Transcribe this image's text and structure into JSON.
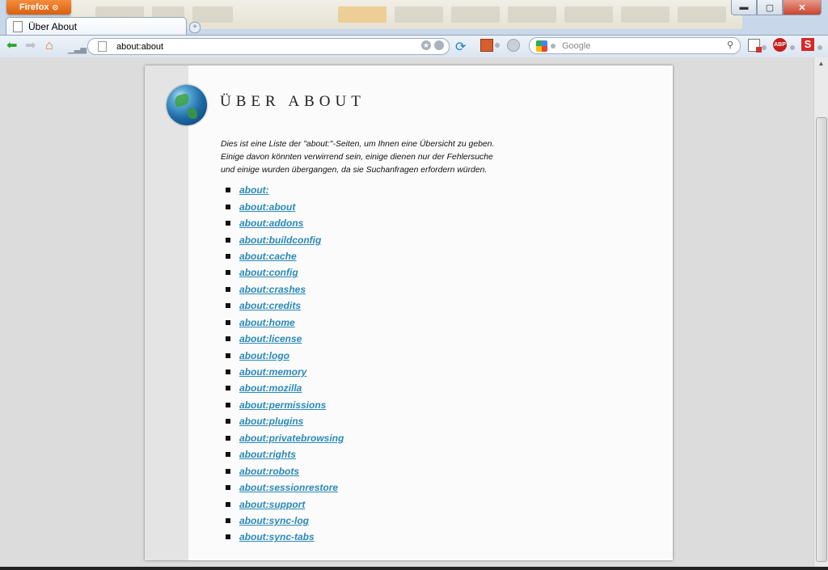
{
  "app": {
    "menu_button_label": "Firefox"
  },
  "tab": {
    "title": "Über About"
  },
  "navbar": {
    "url": "about:about",
    "search_placeholder": "Google"
  },
  "extensions": {
    "adblock_label": "ABP",
    "s_label": "S"
  },
  "page": {
    "title": "ÜBER ABOUT",
    "intro_lines": [
      "Dies ist eine Liste der \"about:\"-Seiten, um Ihnen eine Übersicht zu geben.",
      "Einige davon könnten verwirrend sein, einige dienen nur der Fehlersuche",
      "und einige wurden übergangen, da sie Suchanfragen erfordern würden."
    ],
    "links": [
      "about:",
      "about:about",
      "about:addons",
      "about:buildconfig",
      "about:cache",
      "about:config",
      "about:crashes",
      "about:credits",
      "about:home",
      "about:license",
      "about:logo",
      "about:memory",
      "about:mozilla",
      "about:permissions",
      "about:plugins",
      "about:privatebrowsing",
      "about:rights",
      "about:robots",
      "about:sessionrestore",
      "about:support",
      "about:sync-log",
      "about:sync-tabs"
    ]
  },
  "colors": {
    "link": "#2a89b8",
    "firefox_button": "#e8721f"
  }
}
